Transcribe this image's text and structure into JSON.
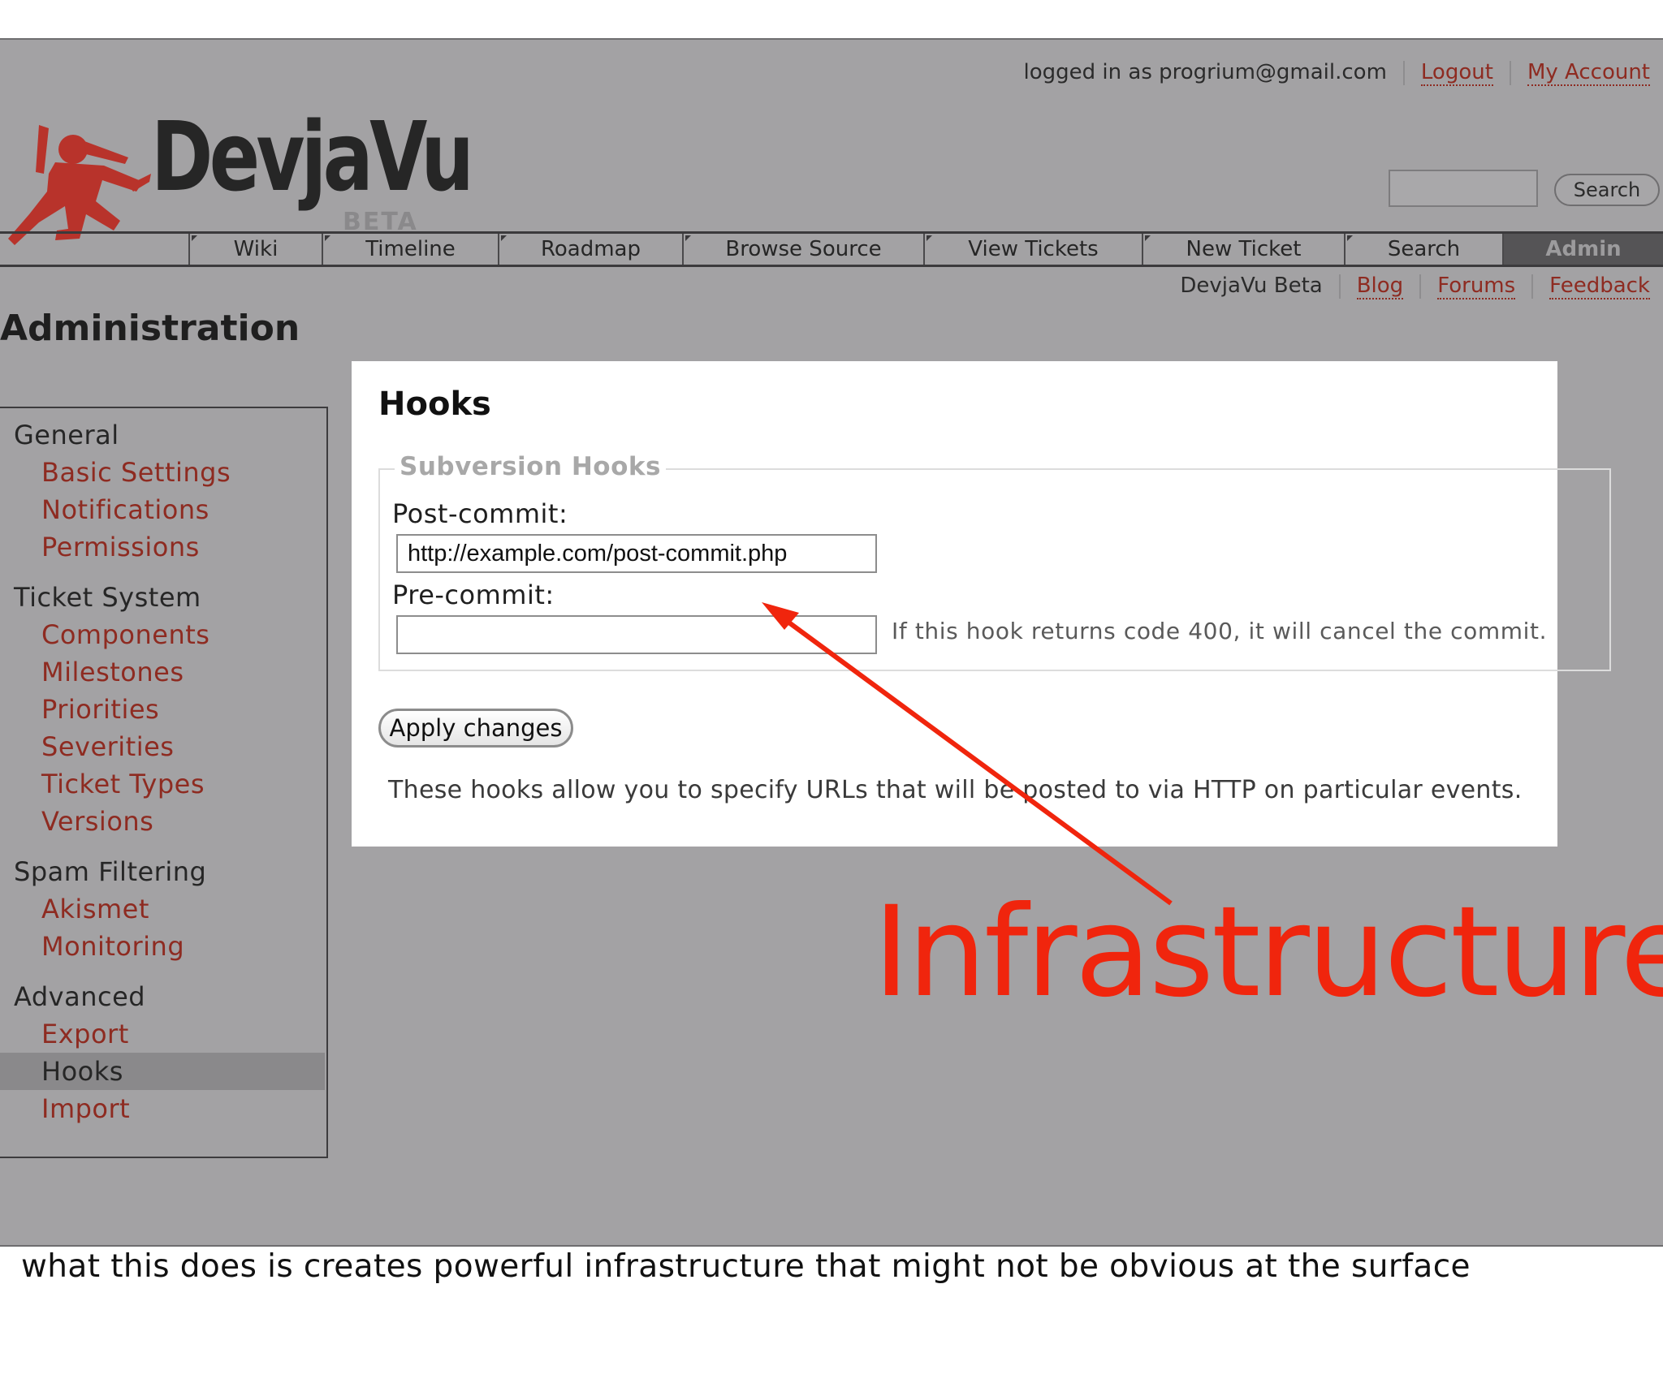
{
  "header": {
    "logged_in": "logged in as progrium@gmail.com",
    "logout": "Logout",
    "my_account": "My Account",
    "logo_text": "DevjaVu",
    "logo_beta": "BETA",
    "search_button": "Search"
  },
  "nav": {
    "tabs": [
      "Wiki",
      "Timeline",
      "Roadmap",
      "Browse Source",
      "View Tickets",
      "New Ticket",
      "Search",
      "Admin"
    ],
    "active": "Admin"
  },
  "subnav": {
    "project": "DevjaVu Beta",
    "blog": "Blog",
    "forums": "Forums",
    "feedback": "Feedback"
  },
  "page_title": "Administration",
  "sidebar": {
    "sections": [
      {
        "title": "General",
        "items": [
          "Basic Settings",
          "Notifications",
          "Permissions"
        ]
      },
      {
        "title": "Ticket System",
        "items": [
          "Components",
          "Milestones",
          "Priorities",
          "Severities",
          "Ticket Types",
          "Versions"
        ]
      },
      {
        "title": "Spam Filtering",
        "items": [
          "Akismet",
          "Monitoring"
        ]
      },
      {
        "title": "Advanced",
        "items": [
          "Export",
          "Hooks",
          "Import"
        ]
      }
    ],
    "active_item": "Hooks"
  },
  "panel": {
    "title": "Hooks",
    "legend": "Subversion Hooks",
    "post_commit_label": "Post-commit:",
    "post_commit_value": "http://example.com/post-commit.php",
    "pre_commit_label": "Pre-commit:",
    "pre_commit_value": "",
    "pre_commit_hint": "If this hook returns code 400, it will cancel the commit.",
    "apply_button": "Apply changes",
    "description": "These hooks allow you to specify URLs that will be posted to via HTTP on particular events."
  },
  "annotation": {
    "text": "Infrastructure",
    "color": "#f0250d"
  },
  "caption": "what this does is creates powerful infrastructure that might not be obvious at the surface",
  "colors": {
    "link": "#8e2b21",
    "background": "#a3a2a4",
    "active_tab": "#555456"
  }
}
